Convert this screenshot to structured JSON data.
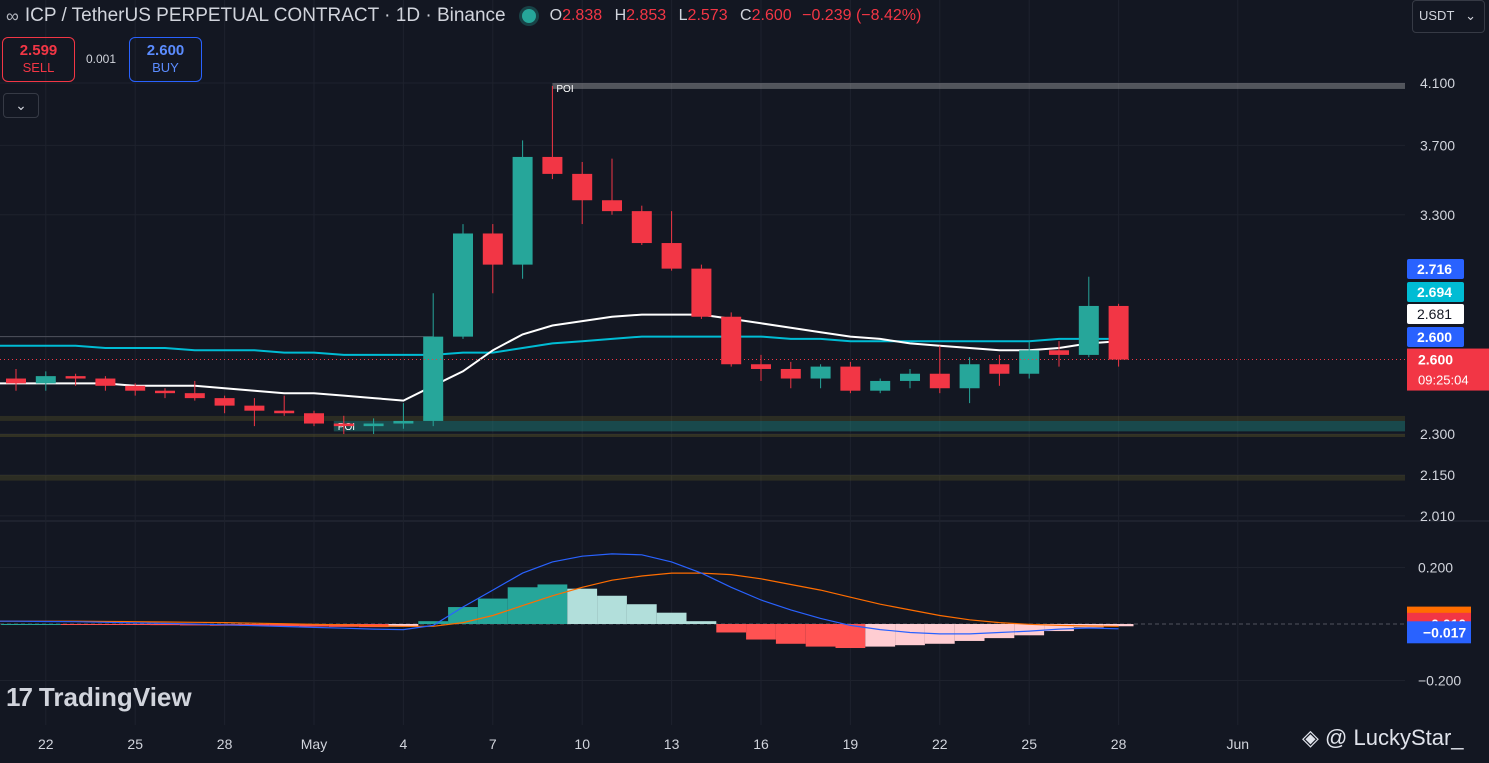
{
  "header": {
    "title": "ICP / TetherUS PERPETUAL CONTRACT · 1D · Binance",
    "o_label": "O",
    "o_value": "2.838",
    "h_label": "H",
    "h_value": "2.853",
    "l_label": "L",
    "l_value": "2.573",
    "c_label": "C",
    "c_value": "2.600",
    "change": "−0.239 (−8.42%)"
  },
  "trade": {
    "sell_price": "2.599",
    "sell_label": "SELL",
    "spread": "0.001",
    "buy_price": "2.600",
    "buy_label": "BUY"
  },
  "currency": {
    "value": "USDT",
    "chevron": "⌄"
  },
  "collapse_icon": "chevron-down-icon",
  "collapse_glyph": "⌄",
  "brand": {
    "name": "TradingView",
    "mark": "17"
  },
  "watermark": "◈ @ LuckyStar_",
  "colors": {
    "up": "#26a69a",
    "down": "#f23645",
    "ma_fast": "#ffffff",
    "ma_slow": "#00bcd4",
    "macd": "#2962ff",
    "signal": "#ff6d00"
  },
  "chart_data": [
    {
      "type": "candlestick",
      "title": "ICP / TetherUS PERPETUAL CONTRACT · 1D · Binance",
      "x": [
        "Apr 21",
        "Apr 22",
        "Apr 23",
        "Apr 24",
        "Apr 25",
        "Apr 26",
        "Apr 27",
        "Apr 28",
        "Apr 29",
        "Apr 30",
        "May 1",
        "May 2",
        "May 3",
        "May 4",
        "May 5",
        "May 6",
        "May 7",
        "May 8",
        "May 9",
        "May 10",
        "May 11",
        "May 12",
        "May 13",
        "May 14",
        "May 15",
        "May 16",
        "May 17",
        "May 18",
        "May 19",
        "May 20",
        "May 21",
        "May 22",
        "May 23",
        "May 24",
        "May 25",
        "May 26",
        "May 27",
        "May 28"
      ],
      "x_ticks": [
        "22",
        "25",
        "28",
        "May",
        "4",
        "7",
        "10",
        "13",
        "16",
        "19",
        "22",
        "25",
        "28",
        "Jun"
      ],
      "x_tick_dates": [
        "Apr 22",
        "Apr 25",
        "Apr 28",
        "May 1",
        "May 4",
        "May 7",
        "May 10",
        "May 13",
        "May 16",
        "May 19",
        "May 22",
        "May 25",
        "May 28",
        "Jun 1"
      ],
      "y_ticks": [
        4.1,
        3.7,
        3.3,
        2.3,
        2.15,
        2.01
      ],
      "y_tick_labels": [
        "4.100",
        "3.700",
        "3.300",
        "2.300",
        "2.150",
        "2.010"
      ],
      "ylim": [
        1.99,
        4.2
      ],
      "scale": "log",
      "ohlc": [
        [
          2.52,
          2.56,
          2.47,
          2.5
        ],
        [
          2.5,
          2.55,
          2.47,
          2.53
        ],
        [
          2.53,
          2.54,
          2.49,
          2.52
        ],
        [
          2.52,
          2.53,
          2.47,
          2.49
        ],
        [
          2.49,
          2.5,
          2.45,
          2.47
        ],
        [
          2.47,
          2.48,
          2.44,
          2.46
        ],
        [
          2.46,
          2.51,
          2.43,
          2.44
        ],
        [
          2.44,
          2.45,
          2.38,
          2.41
        ],
        [
          2.41,
          2.44,
          2.33,
          2.39
        ],
        [
          2.39,
          2.45,
          2.37,
          2.38
        ],
        [
          2.38,
          2.39,
          2.33,
          2.34
        ],
        [
          2.34,
          2.37,
          2.3,
          2.33
        ],
        [
          2.33,
          2.36,
          2.3,
          2.34
        ],
        [
          2.34,
          2.42,
          2.32,
          2.35
        ],
        [
          2.35,
          2.9,
          2.33,
          2.7
        ],
        [
          2.7,
          3.25,
          2.69,
          3.2
        ],
        [
          3.2,
          3.25,
          2.9,
          3.04
        ],
        [
          3.04,
          3.73,
          2.97,
          3.63
        ],
        [
          3.63,
          4.08,
          3.5,
          3.53
        ],
        [
          3.53,
          3.6,
          3.25,
          3.38
        ],
        [
          3.38,
          3.62,
          3.3,
          3.32
        ],
        [
          3.32,
          3.35,
          3.14,
          3.15
        ],
        [
          3.15,
          3.32,
          3.01,
          3.02
        ],
        [
          3.02,
          3.04,
          2.78,
          2.79
        ],
        [
          2.79,
          2.81,
          2.57,
          2.58
        ],
        [
          2.58,
          2.62,
          2.51,
          2.56
        ],
        [
          2.56,
          2.59,
          2.48,
          2.52
        ],
        [
          2.52,
          2.58,
          2.48,
          2.57
        ],
        [
          2.57,
          2.59,
          2.46,
          2.47
        ],
        [
          2.47,
          2.52,
          2.46,
          2.51
        ],
        [
          2.51,
          2.56,
          2.48,
          2.54
        ],
        [
          2.54,
          2.66,
          2.46,
          2.48
        ],
        [
          2.48,
          2.61,
          2.42,
          2.58
        ],
        [
          2.58,
          2.62,
          2.49,
          2.54
        ],
        [
          2.54,
          2.68,
          2.52,
          2.64
        ],
        [
          2.64,
          2.68,
          2.57,
          2.62
        ],
        [
          2.62,
          2.98,
          2.61,
          2.84
        ],
        [
          2.84,
          2.85,
          2.57,
          2.6
        ]
      ],
      "ma_fast": [
        2.5,
        2.5,
        2.5,
        2.5,
        2.49,
        2.49,
        2.49,
        2.48,
        2.47,
        2.46,
        2.46,
        2.45,
        2.44,
        2.43,
        2.49,
        2.55,
        2.64,
        2.71,
        2.75,
        2.77,
        2.79,
        2.8,
        2.8,
        2.8,
        2.78,
        2.76,
        2.74,
        2.72,
        2.7,
        2.69,
        2.67,
        2.66,
        2.65,
        2.64,
        2.64,
        2.65,
        2.67,
        2.68
      ],
      "ma_slow": [
        2.66,
        2.66,
        2.66,
        2.65,
        2.65,
        2.65,
        2.64,
        2.64,
        2.64,
        2.63,
        2.63,
        2.62,
        2.62,
        2.62,
        2.62,
        2.63,
        2.63,
        2.65,
        2.67,
        2.68,
        2.69,
        2.7,
        2.7,
        2.7,
        2.7,
        2.7,
        2.69,
        2.69,
        2.68,
        2.68,
        2.68,
        2.68,
        2.68,
        2.68,
        2.68,
        2.69,
        2.69,
        2.69
      ],
      "last_price": 2.6,
      "price_labels": [
        {
          "value": "2.716",
          "color": "#2962ff",
          "price": 2.716
        },
        {
          "value": "2.694",
          "color": "#00bcd4",
          "price": 2.694
        },
        {
          "value": "2.681",
          "color": "#ffffff",
          "price": 2.681
        },
        {
          "value": "2.600",
          "color": "#2962ff",
          "price": 2.6
        },
        {
          "value": "2.600",
          "color": "#f23645",
          "price": 2.6,
          "countdown": "09:25:04"
        }
      ],
      "poi_zones": [
        {
          "label": "POI",
          "from": 4.06,
          "to": 4.1
        },
        {
          "label": "POI",
          "from": 2.31,
          "to": 2.35
        },
        {
          "label": "",
          "from": 2.13,
          "to": 2.15
        }
      ],
      "grid": true
    },
    {
      "type": "histogram+line",
      "name": "MACD",
      "y_ticks": [
        0.2,
        -0.2
      ],
      "y_tick_labels": [
        "0.200",
        "−0.200"
      ],
      "ylim": [
        -0.23,
        0.24
      ],
      "histogram": [
        0.0,
        0.0,
        -0.001,
        -0.002,
        -0.003,
        -0.004,
        -0.005,
        -0.006,
        -0.007,
        -0.008,
        -0.009,
        -0.01,
        -0.011,
        -0.01,
        0.01,
        0.06,
        0.09,
        0.13,
        0.14,
        0.125,
        0.1,
        0.07,
        0.04,
        0.01,
        -0.03,
        -0.055,
        -0.07,
        -0.08,
        -0.085,
        -0.08,
        -0.075,
        -0.07,
        -0.06,
        -0.05,
        -0.04,
        -0.025,
        -0.012,
        -0.008
      ],
      "macd": [
        0.01,
        0.009,
        0.008,
        0.006,
        0.004,
        0.002,
        0.0,
        -0.003,
        -0.006,
        -0.009,
        -0.012,
        -0.015,
        -0.018,
        -0.02,
        -0.005,
        0.06,
        0.12,
        0.18,
        0.22,
        0.24,
        0.248,
        0.245,
        0.22,
        0.18,
        0.13,
        0.085,
        0.05,
        0.02,
        -0.005,
        -0.02,
        -0.03,
        -0.035,
        -0.035,
        -0.03,
        -0.025,
        -0.018,
        -0.014,
        -0.017
      ],
      "signal": [
        0.01,
        0.01,
        0.01,
        0.009,
        0.008,
        0.007,
        0.006,
        0.005,
        0.003,
        0.001,
        -0.001,
        -0.003,
        -0.006,
        -0.008,
        -0.008,
        0.005,
        0.03,
        0.065,
        0.1,
        0.13,
        0.155,
        0.17,
        0.18,
        0.18,
        0.175,
        0.16,
        0.14,
        0.12,
        0.095,
        0.07,
        0.05,
        0.03,
        0.015,
        0.005,
        -0.001,
        -0.005,
        -0.007,
        -0.008
      ],
      "labels": [
        {
          "value": "−0.008",
          "color": "#ff6d00",
          "v": 0.012
        },
        {
          "value": "−0.010",
          "color": "#f23645",
          "v": -0.01
        },
        {
          "value": "−0.017",
          "color": "#2962ff",
          "v": -0.04
        }
      ]
    }
  ]
}
